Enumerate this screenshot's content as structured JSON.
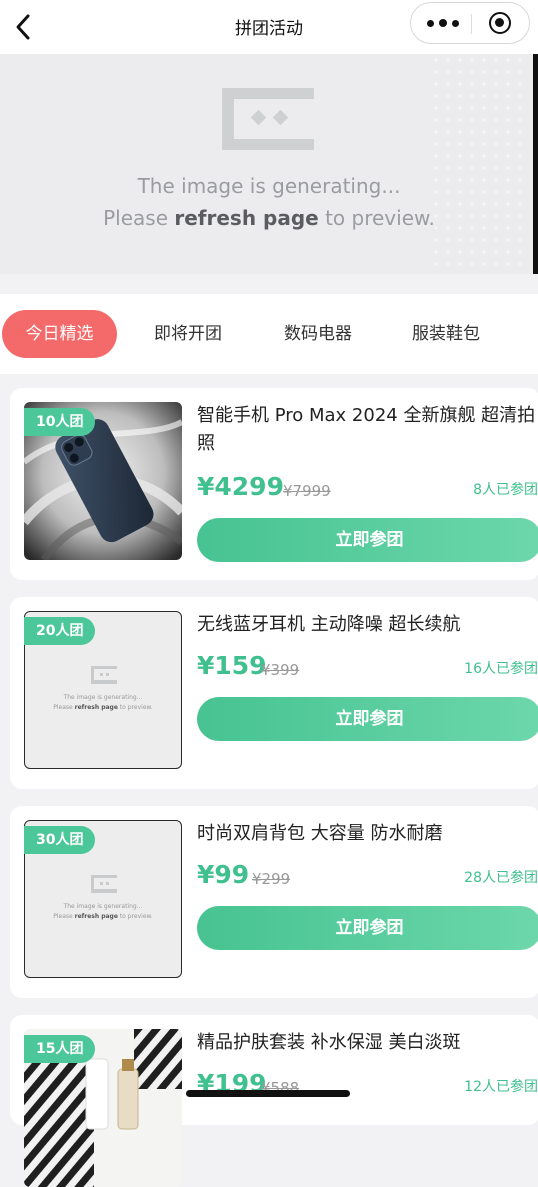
{
  "nav": {
    "title": "拼团活动"
  },
  "banner": {
    "line1": "The image is generating...",
    "line2_pre": "Please ",
    "line2_bold": "refresh page",
    "line2_post": " to preview."
  },
  "tabs": [
    {
      "label": "今日精选",
      "active": true
    },
    {
      "label": "即将开团",
      "active": false
    },
    {
      "label": "数码电器",
      "active": false
    },
    {
      "label": "服装鞋包",
      "active": false
    }
  ],
  "products": [
    {
      "badge": "10人团",
      "name": "智能手机 Pro Max 2024 全新旗舰 超清拍照",
      "price": "¥4299",
      "original_price": "¥7999",
      "joined": "8人已参团",
      "button": "立即参团"
    },
    {
      "badge": "20人团",
      "name": "无线蓝牙耳机 主动降噪 超长续航",
      "price": "¥159",
      "original_price": "¥399",
      "joined": "16人已参团",
      "button": "立即参团"
    },
    {
      "badge": "30人团",
      "name": "时尚双肩背包 大容量 防水耐磨",
      "price": "¥99",
      "original_price": "¥299",
      "joined": "28人已参团",
      "button": "立即参团"
    },
    {
      "badge": "15人团",
      "name": "精品护肤套装 补水保湿 美白淡斑",
      "price": "¥199",
      "original_price": "¥588",
      "joined": "12人已参团"
    }
  ],
  "thumb_placeholder": {
    "line1": "The image is generating...",
    "line2_pre": "Please ",
    "line2_bold": "refresh page",
    "line2_post": " to preview."
  },
  "colors": {
    "accent_green": "#3fc08e",
    "tab_active": "#f46a6a"
  }
}
